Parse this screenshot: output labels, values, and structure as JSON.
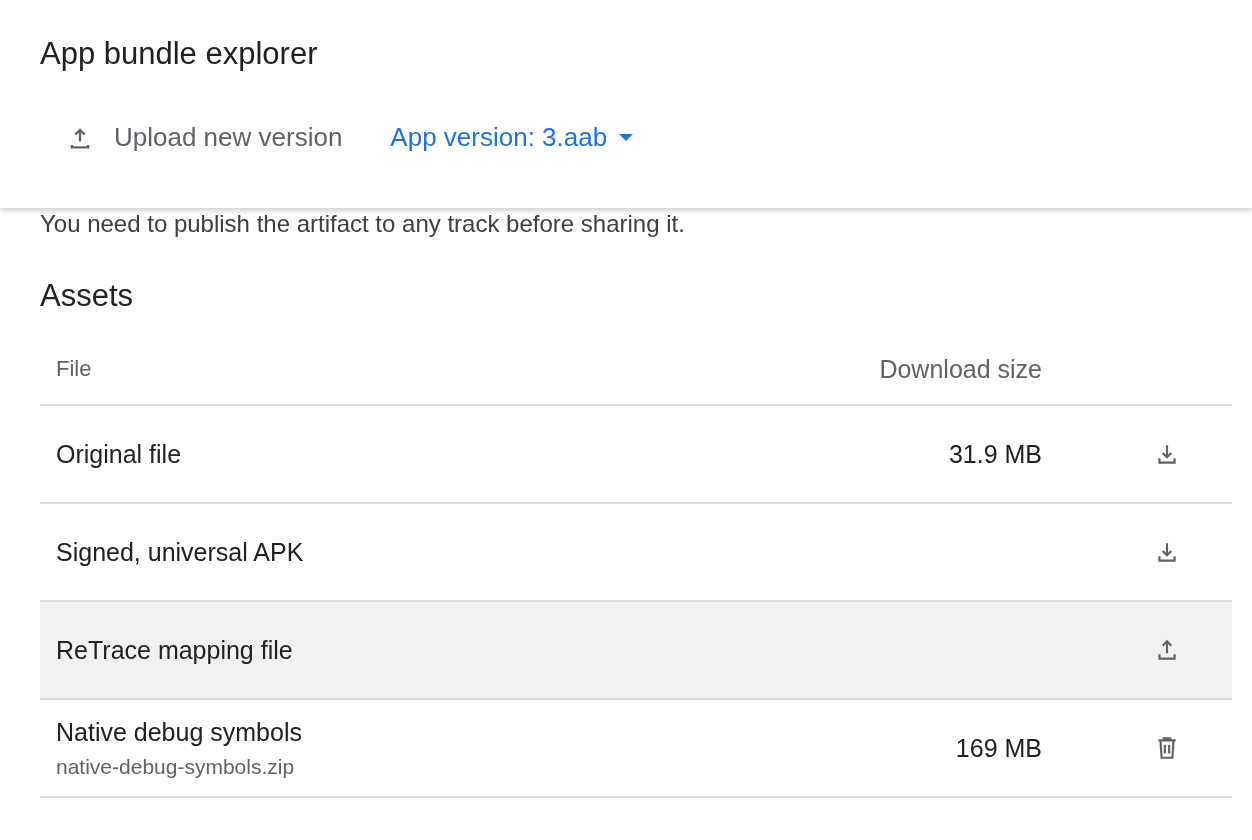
{
  "page": {
    "title": "App bundle explorer"
  },
  "toolbar": {
    "upload_label": "Upload new version",
    "version_label": "App version: 3.aab"
  },
  "message": "You need to publish the artifact to any track before sharing it.",
  "assets": {
    "title": "Assets",
    "columns": [
      "File",
      "Download size"
    ],
    "rows": [
      {
        "name": "Original file",
        "size": "31.9 MB",
        "kind": "download",
        "highlighted": false
      },
      {
        "name": "Signed, universal APK",
        "kind": "download",
        "highlighted": false
      },
      {
        "name": "ReTrace mapping file",
        "kind": "upload",
        "highlighted": true
      },
      {
        "name": "Native debug symbols",
        "subtitle": "native-debug-symbols.zip",
        "size": "169 MB",
        "kind": "delete",
        "highlighted": false
      }
    ]
  }
}
